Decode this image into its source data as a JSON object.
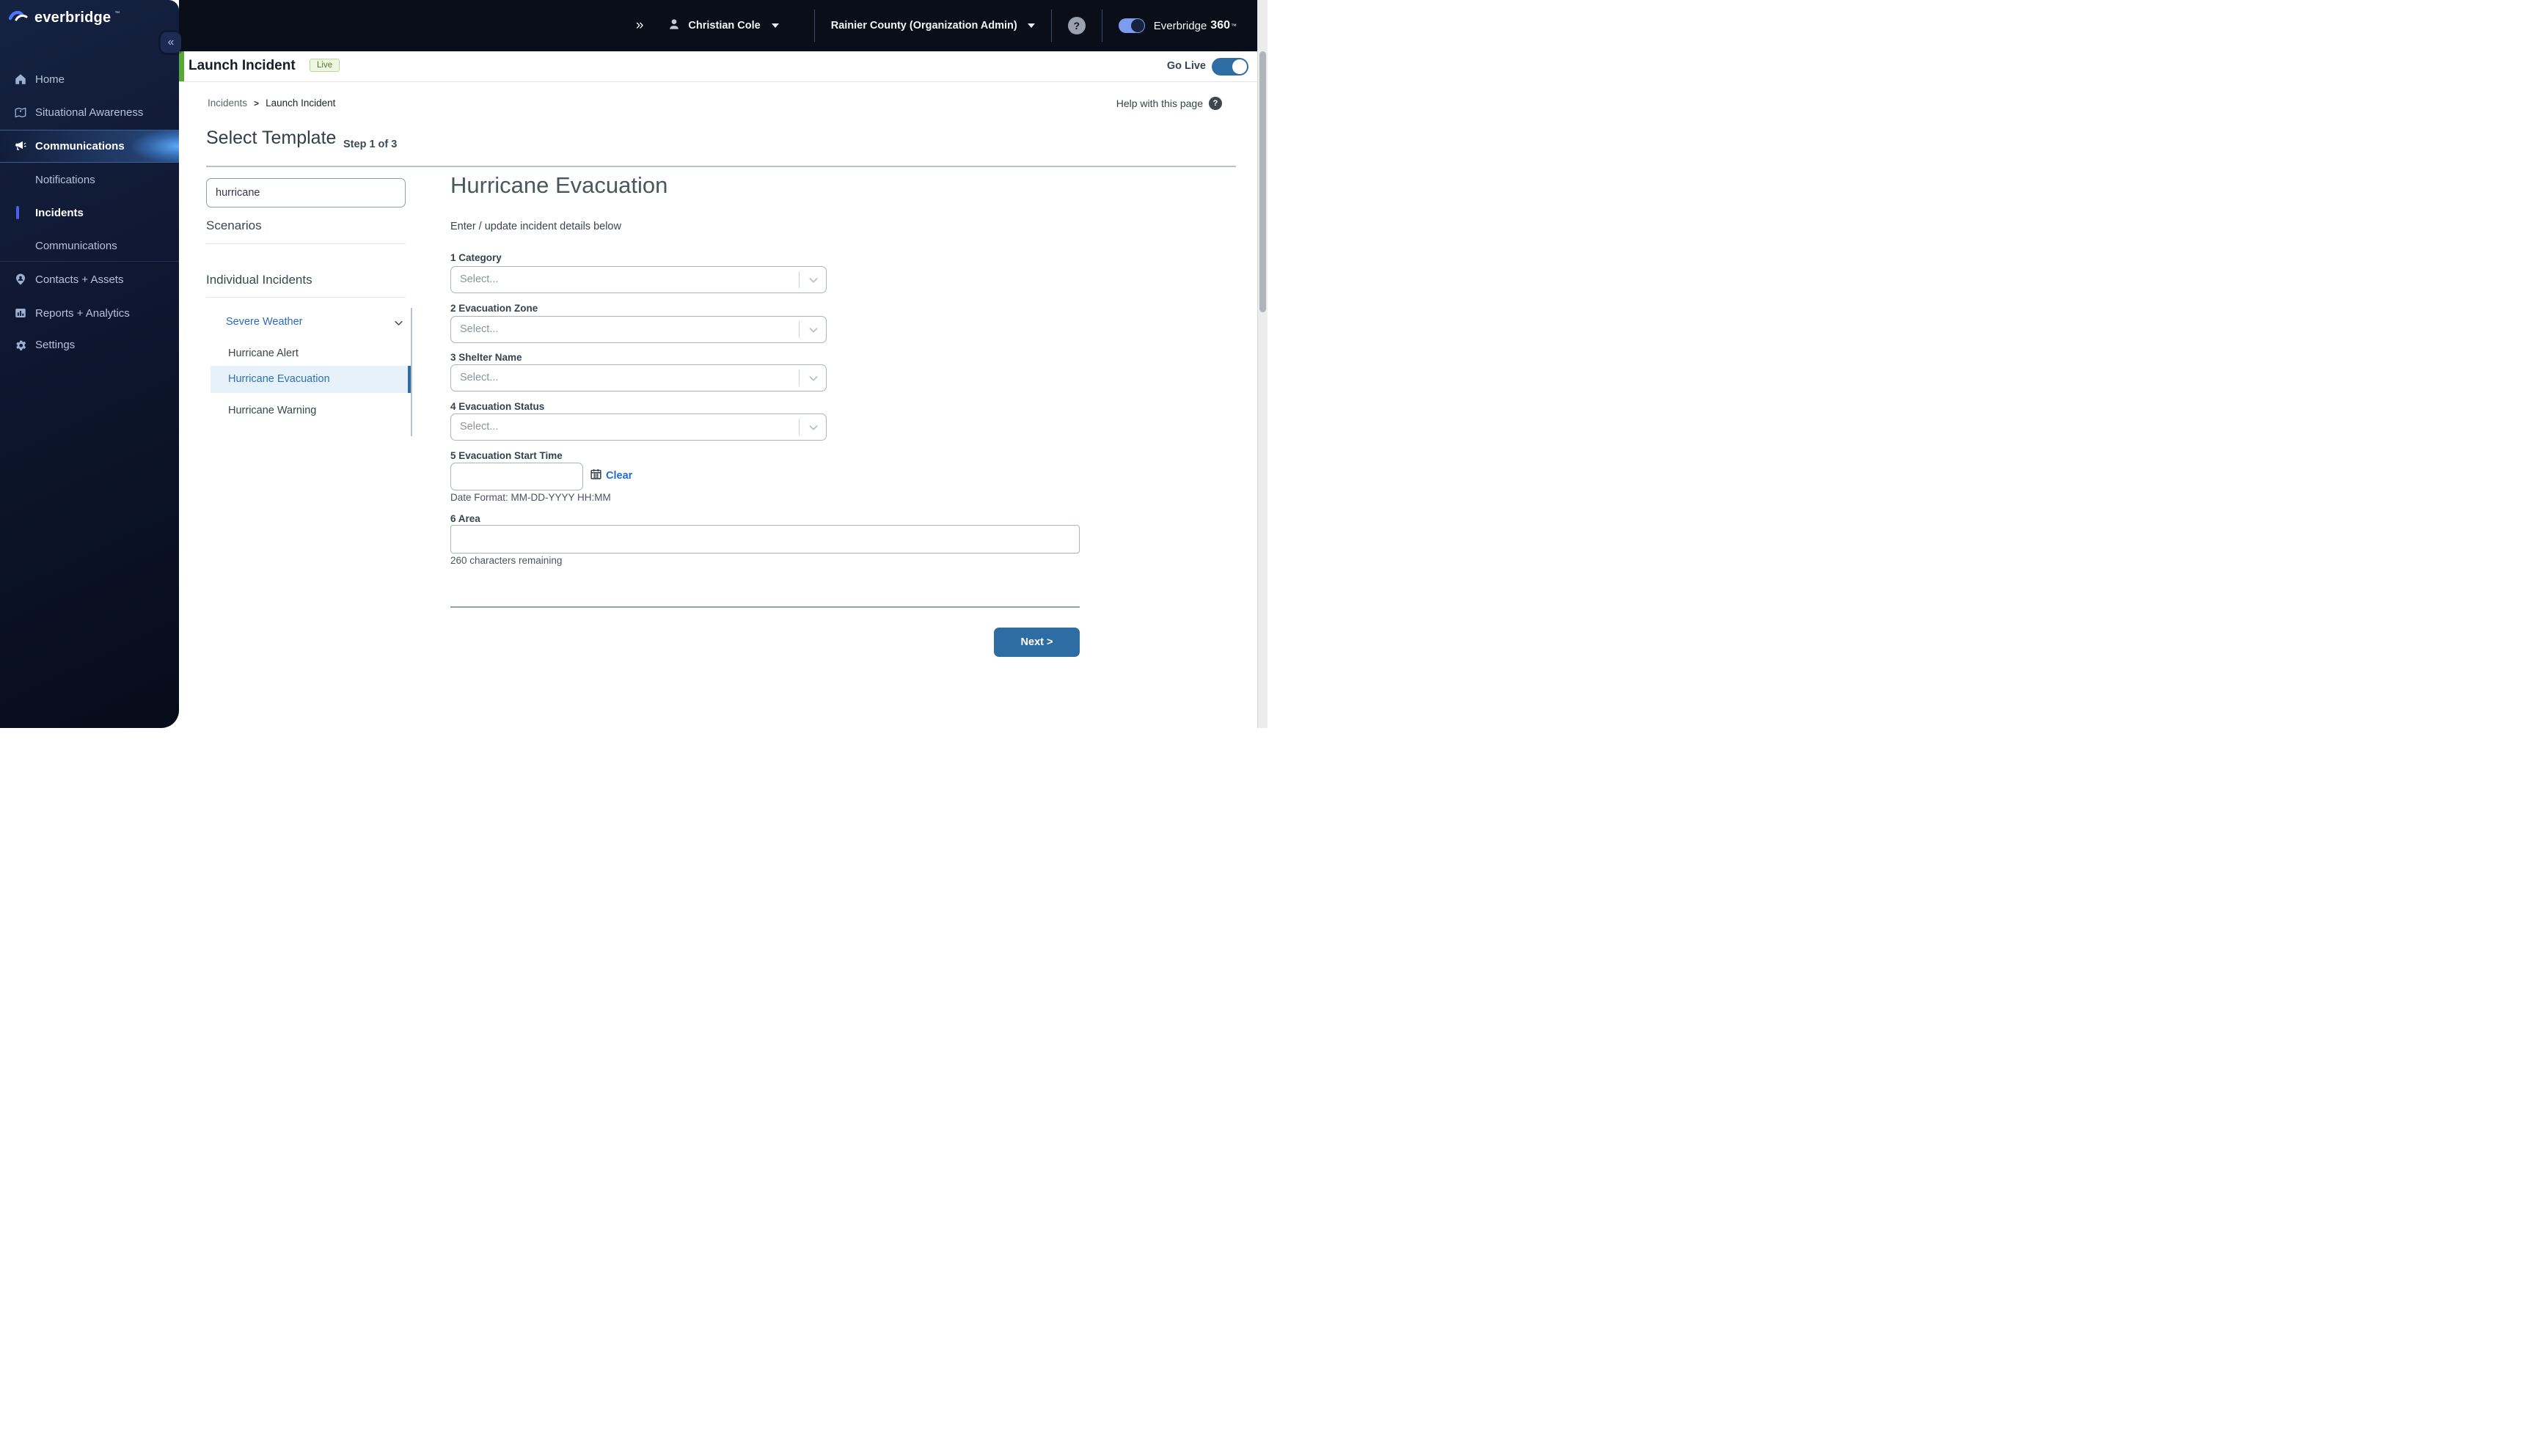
{
  "topbar": {
    "expand_icon": "»",
    "user_name": "Christian Cole",
    "org_name": "Rainier County (Organization Admin)",
    "help_glyph": "?",
    "product_name": "Everbridge",
    "product_suffix": "360",
    "product_tm": "™"
  },
  "sidebar": {
    "logo_text": "everbridge",
    "logo_tm": "™",
    "collapse_glyph": "«",
    "items": [
      {
        "label": "Home"
      },
      {
        "label": "Situational Awareness"
      },
      {
        "label": "Communications"
      },
      {
        "label": "Notifications"
      },
      {
        "label": "Incidents"
      },
      {
        "label": "Communications"
      },
      {
        "label": "Contacts + Assets"
      },
      {
        "label": "Reports + Analytics"
      },
      {
        "label": "Settings"
      }
    ]
  },
  "header": {
    "title": "Launch Incident",
    "live_badge": "Live",
    "go_live_label": "Go Live"
  },
  "breadcrumb": {
    "section": "Incidents",
    "separator": ">",
    "current": "Launch Incident"
  },
  "help_link": {
    "label": "Help with this page",
    "glyph": "?"
  },
  "wizard": {
    "heading": "Select Template",
    "step": "Step 1 of 3"
  },
  "left_panel": {
    "search_value": "hurricane",
    "scenarios_heading": "Scenarios",
    "individual_heading": "Individual Incidents",
    "group_label": "Severe Weather",
    "items": [
      {
        "label": "Hurricane Alert"
      },
      {
        "label": "Hurricane Evacuation"
      },
      {
        "label": "Hurricane Warning"
      }
    ],
    "selected_item": "Hurricane Evacuation"
  },
  "form": {
    "title": "Hurricane Evacuation",
    "subtitle": "Enter / update incident details below",
    "select_fields": [
      {
        "label": "1 Category",
        "value": "Select..."
      },
      {
        "label": "2 Evacuation Zone",
        "value": "Select..."
      },
      {
        "label": "3 Shelter Name",
        "value": "Select..."
      },
      {
        "label": "4 Evacuation Status",
        "value": "Select..."
      }
    ],
    "start_time": {
      "label": "5 Evacuation Start Time",
      "value": "",
      "clear_label": "Clear",
      "format_hint": "Date Format: MM-DD-YYYY HH:MM"
    },
    "area": {
      "label": "6 Area",
      "value": "",
      "remaining_hint": "260 characters remaining"
    },
    "next_label": "Next >"
  },
  "colors": {
    "topbar_bg": "#0a0e19",
    "sidebar_bg": "#0e1730",
    "accent_green": "#56a837",
    "live_badge_bg": "#edf7e3",
    "live_badge_text": "#4c7d2a",
    "primary_blue": "#2e6da4",
    "link_blue": "#2b6cb8",
    "selected_row_bg": "#e7f1fa",
    "active_item_glow": "#5eb0ff",
    "incidents_marker_blue": "#4b5ff0"
  }
}
